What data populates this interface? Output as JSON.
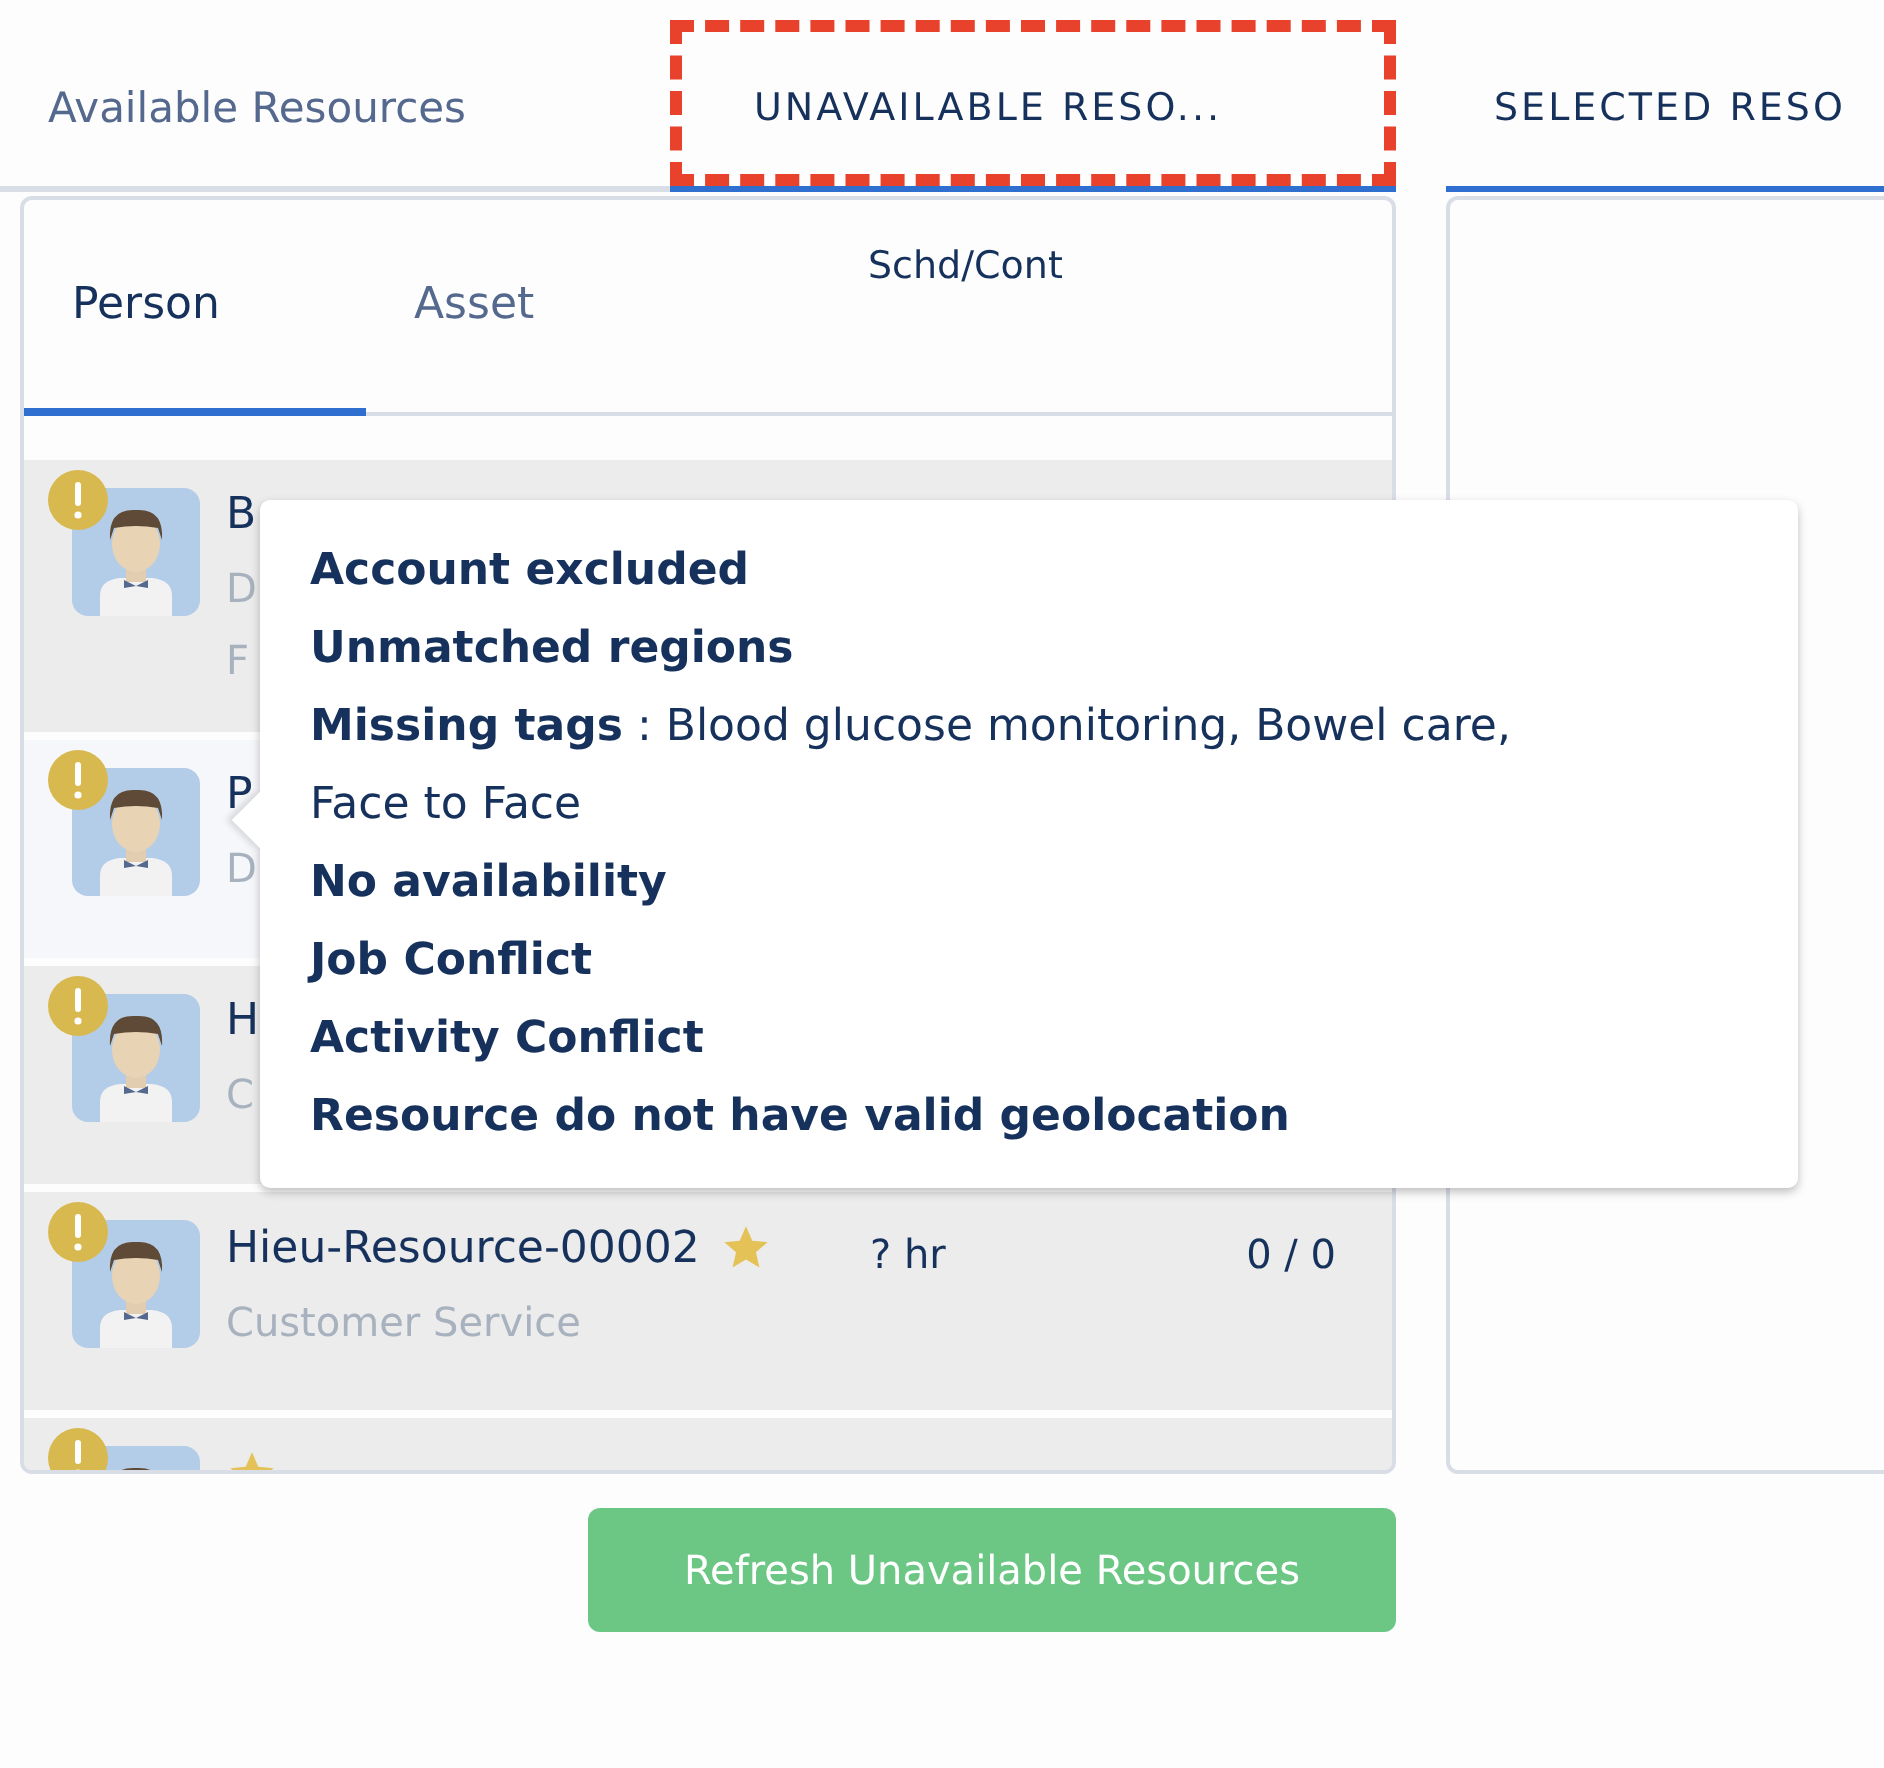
{
  "tabs": [
    {
      "label": "Available Resources",
      "selected": false,
      "highlighted": false
    },
    {
      "label": "UNAVAILABLE RESO...",
      "selected": true,
      "highlighted": true
    }
  ],
  "selected_panel": {
    "title": "SELECTED RESO"
  },
  "sub_tabs": [
    {
      "label": "Person",
      "selected": true
    },
    {
      "label": "Asset",
      "selected": false
    }
  ],
  "column_header": "Schd/Cont",
  "rows": [
    {
      "name": "B",
      "lines": [
        "D",
        "F"
      ],
      "warning": true,
      "hovered": false
    },
    {
      "name": "P",
      "lines": [
        "D"
      ],
      "warning": true,
      "hovered": true
    },
    {
      "name": "H",
      "lines": [
        "C"
      ],
      "warning": true,
      "hovered": false
    },
    {
      "name": "Hieu-Resource-00002",
      "lines": [
        "Customer Service"
      ],
      "starred": true,
      "warning": true,
      "hovered": false,
      "hours": "? hr",
      "count": "0 / 0"
    },
    {
      "starred": true,
      "warning": true,
      "hovered": false
    }
  ],
  "tooltip": {
    "items": [
      "Account excluded",
      "Unmatched regions",
      "**Missing tags** : Blood glucose monitoring, Bowel care, Face to Face",
      "No availability",
      "Job Conflict",
      "Activity Conflict",
      "Resource do not have valid geolocation"
    ]
  },
  "refresh_button": "Refresh Unavailable Resources"
}
